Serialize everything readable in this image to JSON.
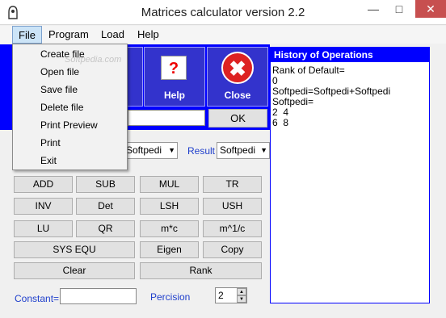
{
  "window": {
    "title": "Matrices calculator version 2.2",
    "minimize": "—",
    "maximize": "□",
    "close": "✕"
  },
  "menubar": {
    "items": [
      "File",
      "Program",
      "Load",
      "Help"
    ]
  },
  "file_menu": {
    "items": [
      "Create file",
      "Open file",
      "Save file",
      "Delete file",
      "Print Preview",
      "Print",
      "Exit"
    ]
  },
  "toolbar": {
    "help_label": "Help",
    "close_label": "Close",
    "help_glyph": "?",
    "close_glyph": "✖"
  },
  "input_row": {
    "ok_label": "OK",
    "value": ""
  },
  "selects": {
    "left_value": "Softpedi",
    "result_label": "Result",
    "result_value": "Softpedi"
  },
  "operations": [
    "ADD",
    "SUB",
    "MUL",
    "TR",
    "INV",
    "Det",
    "LSH",
    "USH",
    "LU",
    "QR",
    "m*c",
    "m^1/c",
    "SYS EQU",
    "Eigen",
    "Copy",
    "Clear",
    "Rank"
  ],
  "history": {
    "title": "History of Operations",
    "lines": [
      "Rank of Default=",
      "0",
      "Softpedi=Softpedi+Softpedi",
      "Softpedi=",
      "2  4",
      "6  8"
    ]
  },
  "constant": {
    "label": "Constant=",
    "value": ""
  },
  "percision": {
    "label": "Percision",
    "value": "2"
  },
  "watermark": "Softpedia.com",
  "colors": {
    "accent_blue": "#0000FF",
    "label_blue": "#1F3FCC",
    "close_red": "#D22222"
  }
}
